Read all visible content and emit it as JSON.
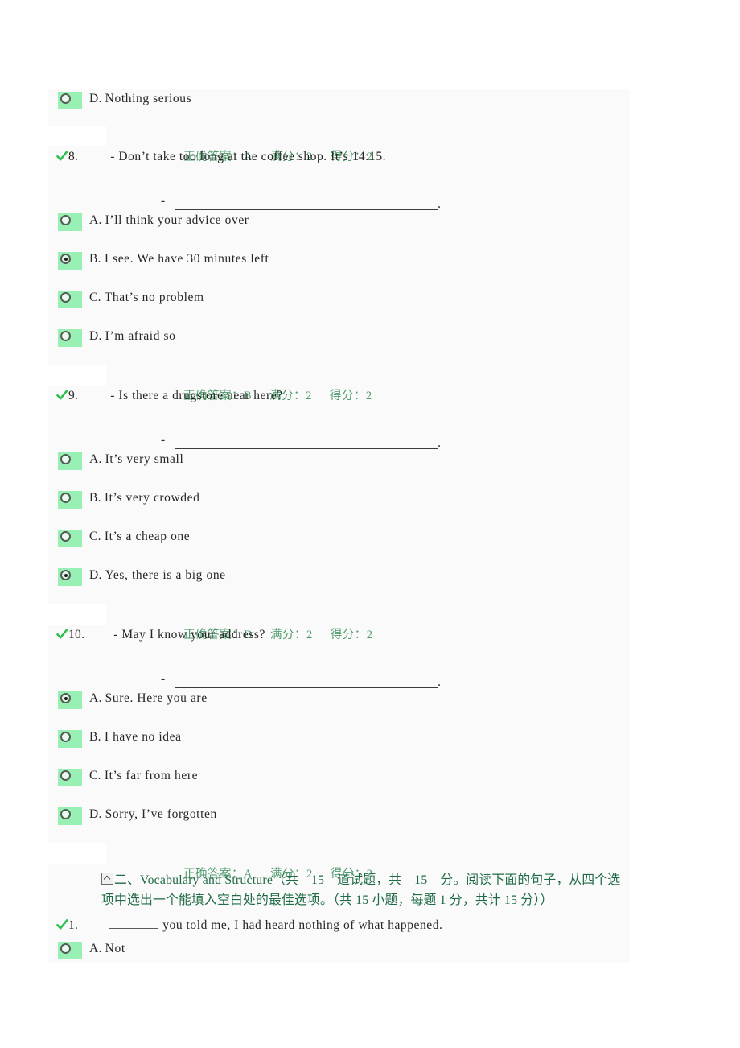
{
  "page": {
    "background": "#ffffff",
    "content_background": "#fafafa",
    "accent_green": "#99f0b4",
    "answer_text_color": "#4d9a6a",
    "section_text_color": "#1f6b45",
    "check_color": "#2fbf4f"
  },
  "labels": {
    "correct_answer": "正确答案：",
    "full_score": "满分：",
    "earned_score": "得分："
  },
  "blocks": [
    {
      "kind": "orphan_option",
      "option": {
        "letter": "D.",
        "text": "Nothing serious",
        "selected": false
      }
    },
    {
      "kind": "answer_line",
      "correct": "A",
      "full": "2",
      "earned": "2"
    },
    {
      "kind": "question",
      "number": "8.",
      "prompt": "- Don’t take too long at the coffee shop. It’s 14:15.",
      "reply_dash": "-",
      "reply_period": ".",
      "options": [
        {
          "letter": "A.",
          "text": "I’ll think your advice over",
          "selected": false
        },
        {
          "letter": "B.",
          "text": "I see. We have 30 minutes left",
          "selected": true
        },
        {
          "letter": "C.",
          "text": "That’s no problem",
          "selected": false
        },
        {
          "letter": "D.",
          "text": "I’m afraid so",
          "selected": false
        }
      ],
      "answer": {
        "correct": "B",
        "full": "2",
        "earned": "2"
      }
    },
    {
      "kind": "question",
      "number": "9.",
      "prompt": "- Is there a drugstore near here?",
      "reply_dash": "-",
      "reply_period": ".",
      "options": [
        {
          "letter": "A.",
          "text": "It’s very small",
          "selected": false
        },
        {
          "letter": "B.",
          "text": "It’s very crowded",
          "selected": false
        },
        {
          "letter": "C.",
          "text": "It’s a cheap one",
          "selected": false
        },
        {
          "letter": "D.",
          "text": "Yes, there is a big one",
          "selected": true
        }
      ],
      "answer": {
        "correct": "D",
        "full": "2",
        "earned": "2"
      }
    },
    {
      "kind": "question",
      "number": "10.",
      "prompt": "- May I know your address?",
      "reply_dash": "-",
      "reply_period": ".",
      "options": [
        {
          "letter": "A.",
          "text": "Sure. Here you are",
          "selected": true
        },
        {
          "letter": "B.",
          "text": "I have no idea",
          "selected": false
        },
        {
          "letter": "C.",
          "text": "It’s far from here",
          "selected": false
        },
        {
          "letter": "D.",
          "text": "Sorry, I’ve forgotten",
          "selected": false
        }
      ],
      "answer": {
        "correct": "A",
        "full": "2",
        "earned": "2"
      }
    },
    {
      "kind": "section_header",
      "icon": "collapse-icon",
      "text": "二、Vocabulary and Structure（共　15　道试题，共　15　分。阅读下面的句子，从四个选项中选出一个能填入空白处的最佳选项。（共 15 小题，每题 1 分，共计 15 分））"
    },
    {
      "kind": "fill_question",
      "number": "1.",
      "before_blank": "",
      "after_blank": "you told me, I had heard nothing of what happened.",
      "options": [
        {
          "letter": "A.",
          "text": "Not",
          "selected": false
        }
      ]
    }
  ]
}
